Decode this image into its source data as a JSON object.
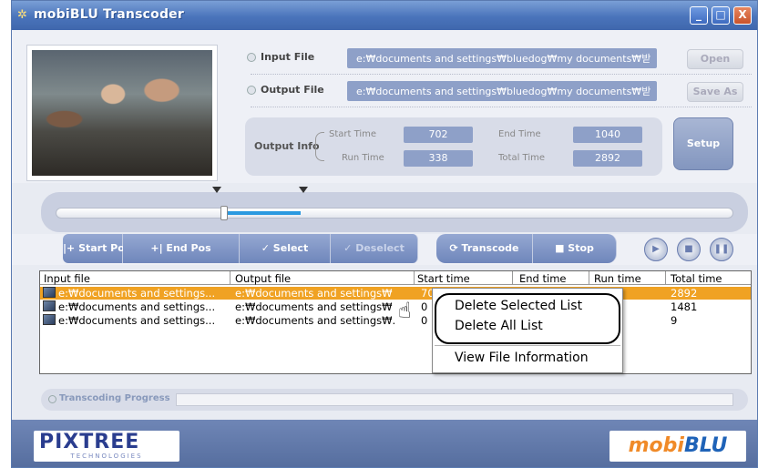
{
  "window": {
    "title": "mobiBLU Transcoder",
    "min": "_",
    "max": "□",
    "close": "X"
  },
  "files": {
    "input_label": "Input File",
    "input_path": "e:₩documents and settings₩bluedog₩my documents₩받",
    "output_label": "Output File",
    "output_path": "e:₩documents and settings₩bluedog₩my documents₩받",
    "open_label": "Open",
    "save_as_label": "Save As"
  },
  "output_info": {
    "label": "Output Info",
    "start_time_label": "Start Time",
    "start_time": "702",
    "end_time_label": "End Time",
    "end_time": "1040",
    "run_time_label": "Run Time",
    "run_time": "338",
    "total_time_label": "Total Time",
    "total_time": "2892",
    "setup_label": "Setup"
  },
  "controls": {
    "start_pos": "|+ Start Pos",
    "end_pos": "+| End Pos",
    "select": "✓ Select",
    "deselect": "✓ Deselect",
    "transcode": "⟳ Transcode",
    "stop": "■  Stop"
  },
  "list": {
    "columns": [
      "Input file",
      "Output file",
      "Start time",
      "End time",
      "Run time",
      "Total time"
    ],
    "rows": [
      {
        "input": "e:₩documents and settings...",
        "output": "e:₩documents and settings₩",
        "start": "70",
        "total": "2892"
      },
      {
        "input": "e:₩documents and settings...",
        "output": "e:₩documents and settings₩",
        "start": "0",
        "total": "1481"
      },
      {
        "input": "e:₩documents and settings...",
        "output": "e:₩documents and settings₩.",
        "start": "0",
        "total": "9"
      }
    ]
  },
  "context_menu": {
    "delete_selected": "Delete Selected List",
    "delete_all": "Delete All List",
    "view_info": "View File Information"
  },
  "progress": {
    "label": "Transcoding Progress",
    "value": 0
  },
  "footer": {
    "left_logo": "PIXTREE",
    "left_logo_sub": "TECHNOLOGIES",
    "right_logo_a": "mobi",
    "right_logo_b": "BLU"
  },
  "timeline": {
    "selection_start_fraction": 0.24,
    "selection_end_fraction": 0.36
  }
}
